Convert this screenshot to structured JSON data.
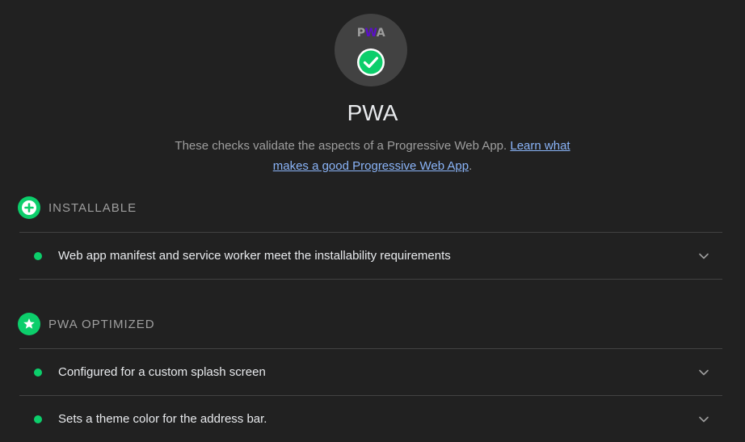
{
  "category": {
    "logo_text": [
      "P",
      "W",
      "A"
    ],
    "title": "PWA",
    "description_prefix": "These checks validate the aspects of a Progressive Web App. ",
    "learn_more_link": "Learn what makes a good Progressive Web App",
    "description_suffix": ".",
    "score_state": "pass",
    "icon": "check-circle-icon"
  },
  "groups": [
    {
      "title": "INSTALLABLE",
      "icon": "plus-circle-icon",
      "audits": [
        {
          "label": "Web app manifest and service worker meet the installability requirements",
          "status": "pass"
        }
      ]
    },
    {
      "title": "PWA OPTIMIZED",
      "icon": "star-circle-icon",
      "audits": [
        {
          "label": "Configured for a custom splash screen",
          "status": "pass"
        },
        {
          "label": "Sets a theme color for the address bar.",
          "status": "pass"
        }
      ]
    }
  ],
  "colors": {
    "pass": "#0cce6b",
    "background": "#212121",
    "link": "#8ab4f8",
    "gauge_bg": "#424242"
  }
}
